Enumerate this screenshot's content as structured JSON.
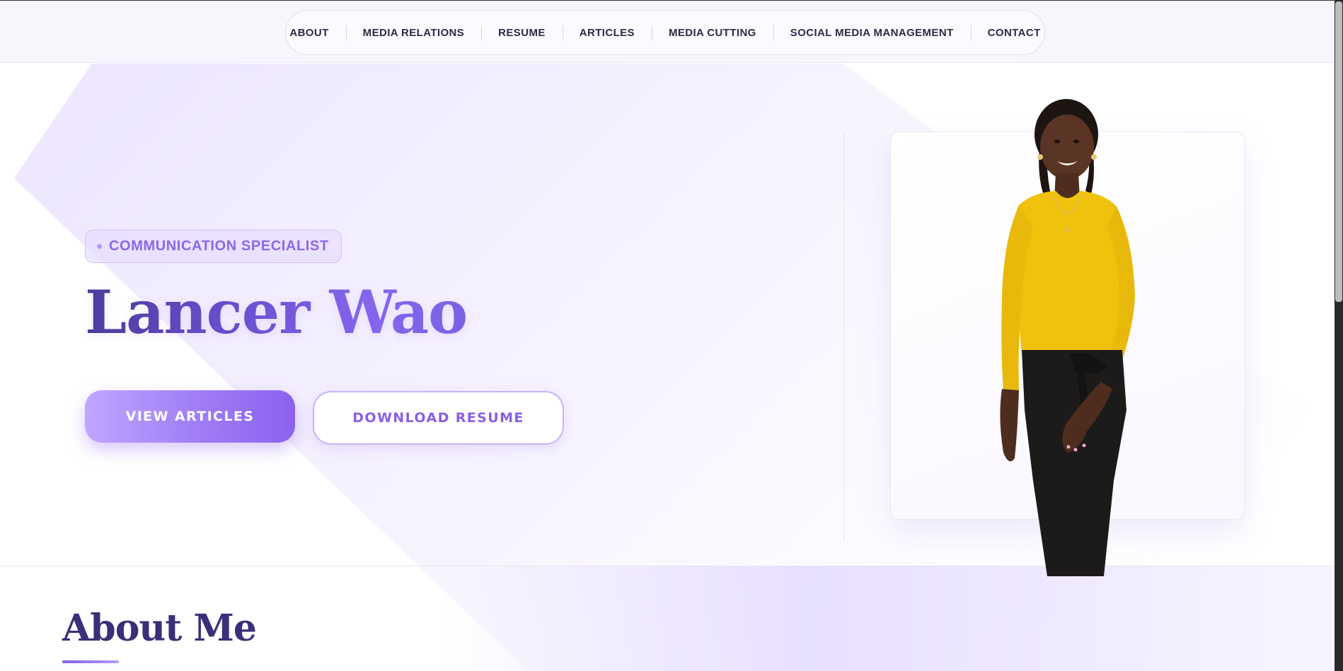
{
  "nav": {
    "items": [
      {
        "label": "ABOUT"
      },
      {
        "label": "MEDIA RELATIONS"
      },
      {
        "label": "RESUME"
      },
      {
        "label": "ARTICLES"
      },
      {
        "label": "MEDIA CUTTING"
      },
      {
        "label": "SOCIAL MEDIA MANAGEMENT"
      },
      {
        "label": "CONTACT"
      }
    ]
  },
  "hero": {
    "badge": "COMMUNICATION SPECIALIST",
    "title": "Lancer Wao",
    "primary_button": "VIEW ARTICLES",
    "secondary_button": "DOWNLOAD RESUME"
  },
  "about": {
    "title": "About Me"
  },
  "colors": {
    "accent": "#8b62ef",
    "title_dark": "#3a2f78",
    "badge_text": "#8d68e6"
  }
}
